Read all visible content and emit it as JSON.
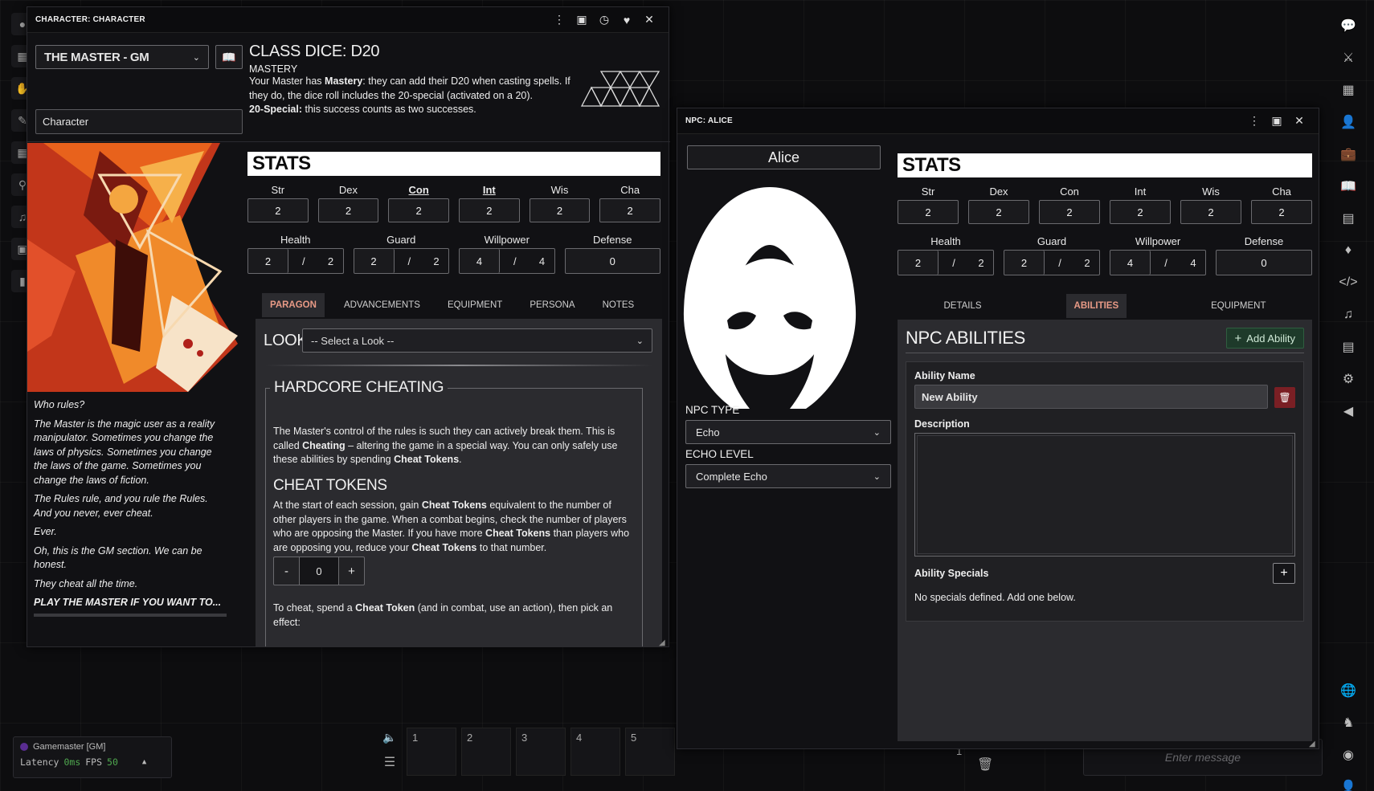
{
  "left_window": {
    "title": "CHARACTER: CHARACTER",
    "class_select": "THE MASTER - GM",
    "name_input": "Character",
    "class_dice": "CLASS DICE: D20",
    "mastery_heading": "MASTERY",
    "mastery_text_1": "Your Master has ",
    "mastery_bold": "Mastery",
    "mastery_text_2": ": they can add their D20 when casting spells. If they do, the dice roll includes the 20-special (activated on a 20).",
    "special_bold": "20-Special:",
    "special_text": " this success counts as two successes.",
    "stats_title": "STATS",
    "stats": [
      {
        "label": "Str",
        "value": "2"
      },
      {
        "label": "Dex",
        "value": "2"
      },
      {
        "label": "Con",
        "value": "2"
      },
      {
        "label": "Int",
        "value": "2"
      },
      {
        "label": "Wis",
        "value": "2"
      },
      {
        "label": "Cha",
        "value": "2"
      }
    ],
    "resources": {
      "health": {
        "label": "Health",
        "current": "2",
        "max": "2"
      },
      "guard": {
        "label": "Guard",
        "current": "2",
        "max": "2"
      },
      "willpower": {
        "label": "Willpower",
        "current": "4",
        "max": "4"
      },
      "defense": {
        "label": "Defense",
        "value": "0"
      }
    },
    "tabs": [
      "PARAGON",
      "ADVANCEMENTS",
      "EQUIPMENT",
      "PERSONA",
      "NOTES"
    ],
    "look_label": "LOOK:",
    "look_select": "-- Select a Look --",
    "section_title": "HARDCORE CHEATING",
    "cheat_intro_1": "The Master's control of the rules is such they can actively break them. This is called ",
    "cheat_intro_b1": "Cheating",
    "cheat_intro_2": " – altering the game in a special way. You can only safely use these abilities by spending ",
    "cheat_intro_b2": "Cheat Tokens",
    "cheat_intro_3": ".",
    "tokens_title": "CHEAT TOKENS",
    "tokens_1": "At the start of each session, gain ",
    "tokens_b1": "Cheat Tokens",
    "tokens_2": " equivalent to the number of other players in the game. When a combat begins, check the number of players who are opposing the Master. If you have more ",
    "tokens_b2": "Cheat Tokens",
    "tokens_3": " than players who are opposing you, reduce your ",
    "tokens_b3": "Cheat Tokens",
    "tokens_4": " to that number.",
    "counter": {
      "minus": "-",
      "value": "0",
      "plus": "+"
    },
    "spend_1": "To cheat, spend a ",
    "spend_b": "Cheat Token",
    "spend_2": " (and in combat, use an action), then pick an effect:",
    "lore": {
      "q": "Who rules?",
      "p1": "The Master is the magic user as a reality manipulator. Sometimes you change the laws of physics. Sometimes you change the laws of the game. Sometimes you change the laws of fiction.",
      "p2": "The Rules rule, and you rule the Rules. And you never, ever cheat.",
      "p3": "Ever.",
      "p4": "Oh, this is the GM section. We can be honest.",
      "p5": "They cheat all the time.",
      "p6": "PLAY THE MASTER IF YOU WANT TO..."
    }
  },
  "right_window": {
    "title": "NPC: ALICE",
    "name": "Alice",
    "stats_title": "STATS",
    "stats": [
      {
        "label": "Str",
        "value": "2"
      },
      {
        "label": "Dex",
        "value": "2"
      },
      {
        "label": "Con",
        "value": "2"
      },
      {
        "label": "Int",
        "value": "2"
      },
      {
        "label": "Wis",
        "value": "2"
      },
      {
        "label": "Cha",
        "value": "2"
      }
    ],
    "resources": {
      "health": {
        "label": "Health",
        "current": "2",
        "max": "2"
      },
      "guard": {
        "label": "Guard",
        "current": "2",
        "max": "2"
      },
      "willpower": {
        "label": "Willpower",
        "current": "4",
        "max": "4"
      },
      "defense": {
        "label": "Defense",
        "value": "0"
      }
    },
    "tabs": [
      "DETAILS",
      "ABILITIES",
      "EQUIPMENT"
    ],
    "npc_type_label": "NPC TYPE",
    "npc_type": "Echo",
    "echo_level_label": "ECHO LEVEL",
    "echo_level": "Complete Echo",
    "abilities_title": "NPC ABILITIES",
    "add_ability": "Add Ability",
    "ability_name_label": "Ability Name",
    "ability_name": "New Ability",
    "description_label": "Description",
    "specials_label": "Ability Specials",
    "no_specials": "No specials defined. Add one below."
  },
  "bottom": {
    "player": "Gamemaster [GM]",
    "latency_label": "Latency",
    "latency_value": "0ms",
    "fps_label": "FPS",
    "fps_value": "50",
    "hotbar": [
      "1",
      "2",
      "3",
      "4",
      "5"
    ],
    "hotbar_page": "1",
    "chat_placeholder": "Enter message"
  },
  "colors": {
    "accent_tab": "#e89a86",
    "add_button": "#1e3a2a",
    "delete_button": "#7a1f24"
  }
}
